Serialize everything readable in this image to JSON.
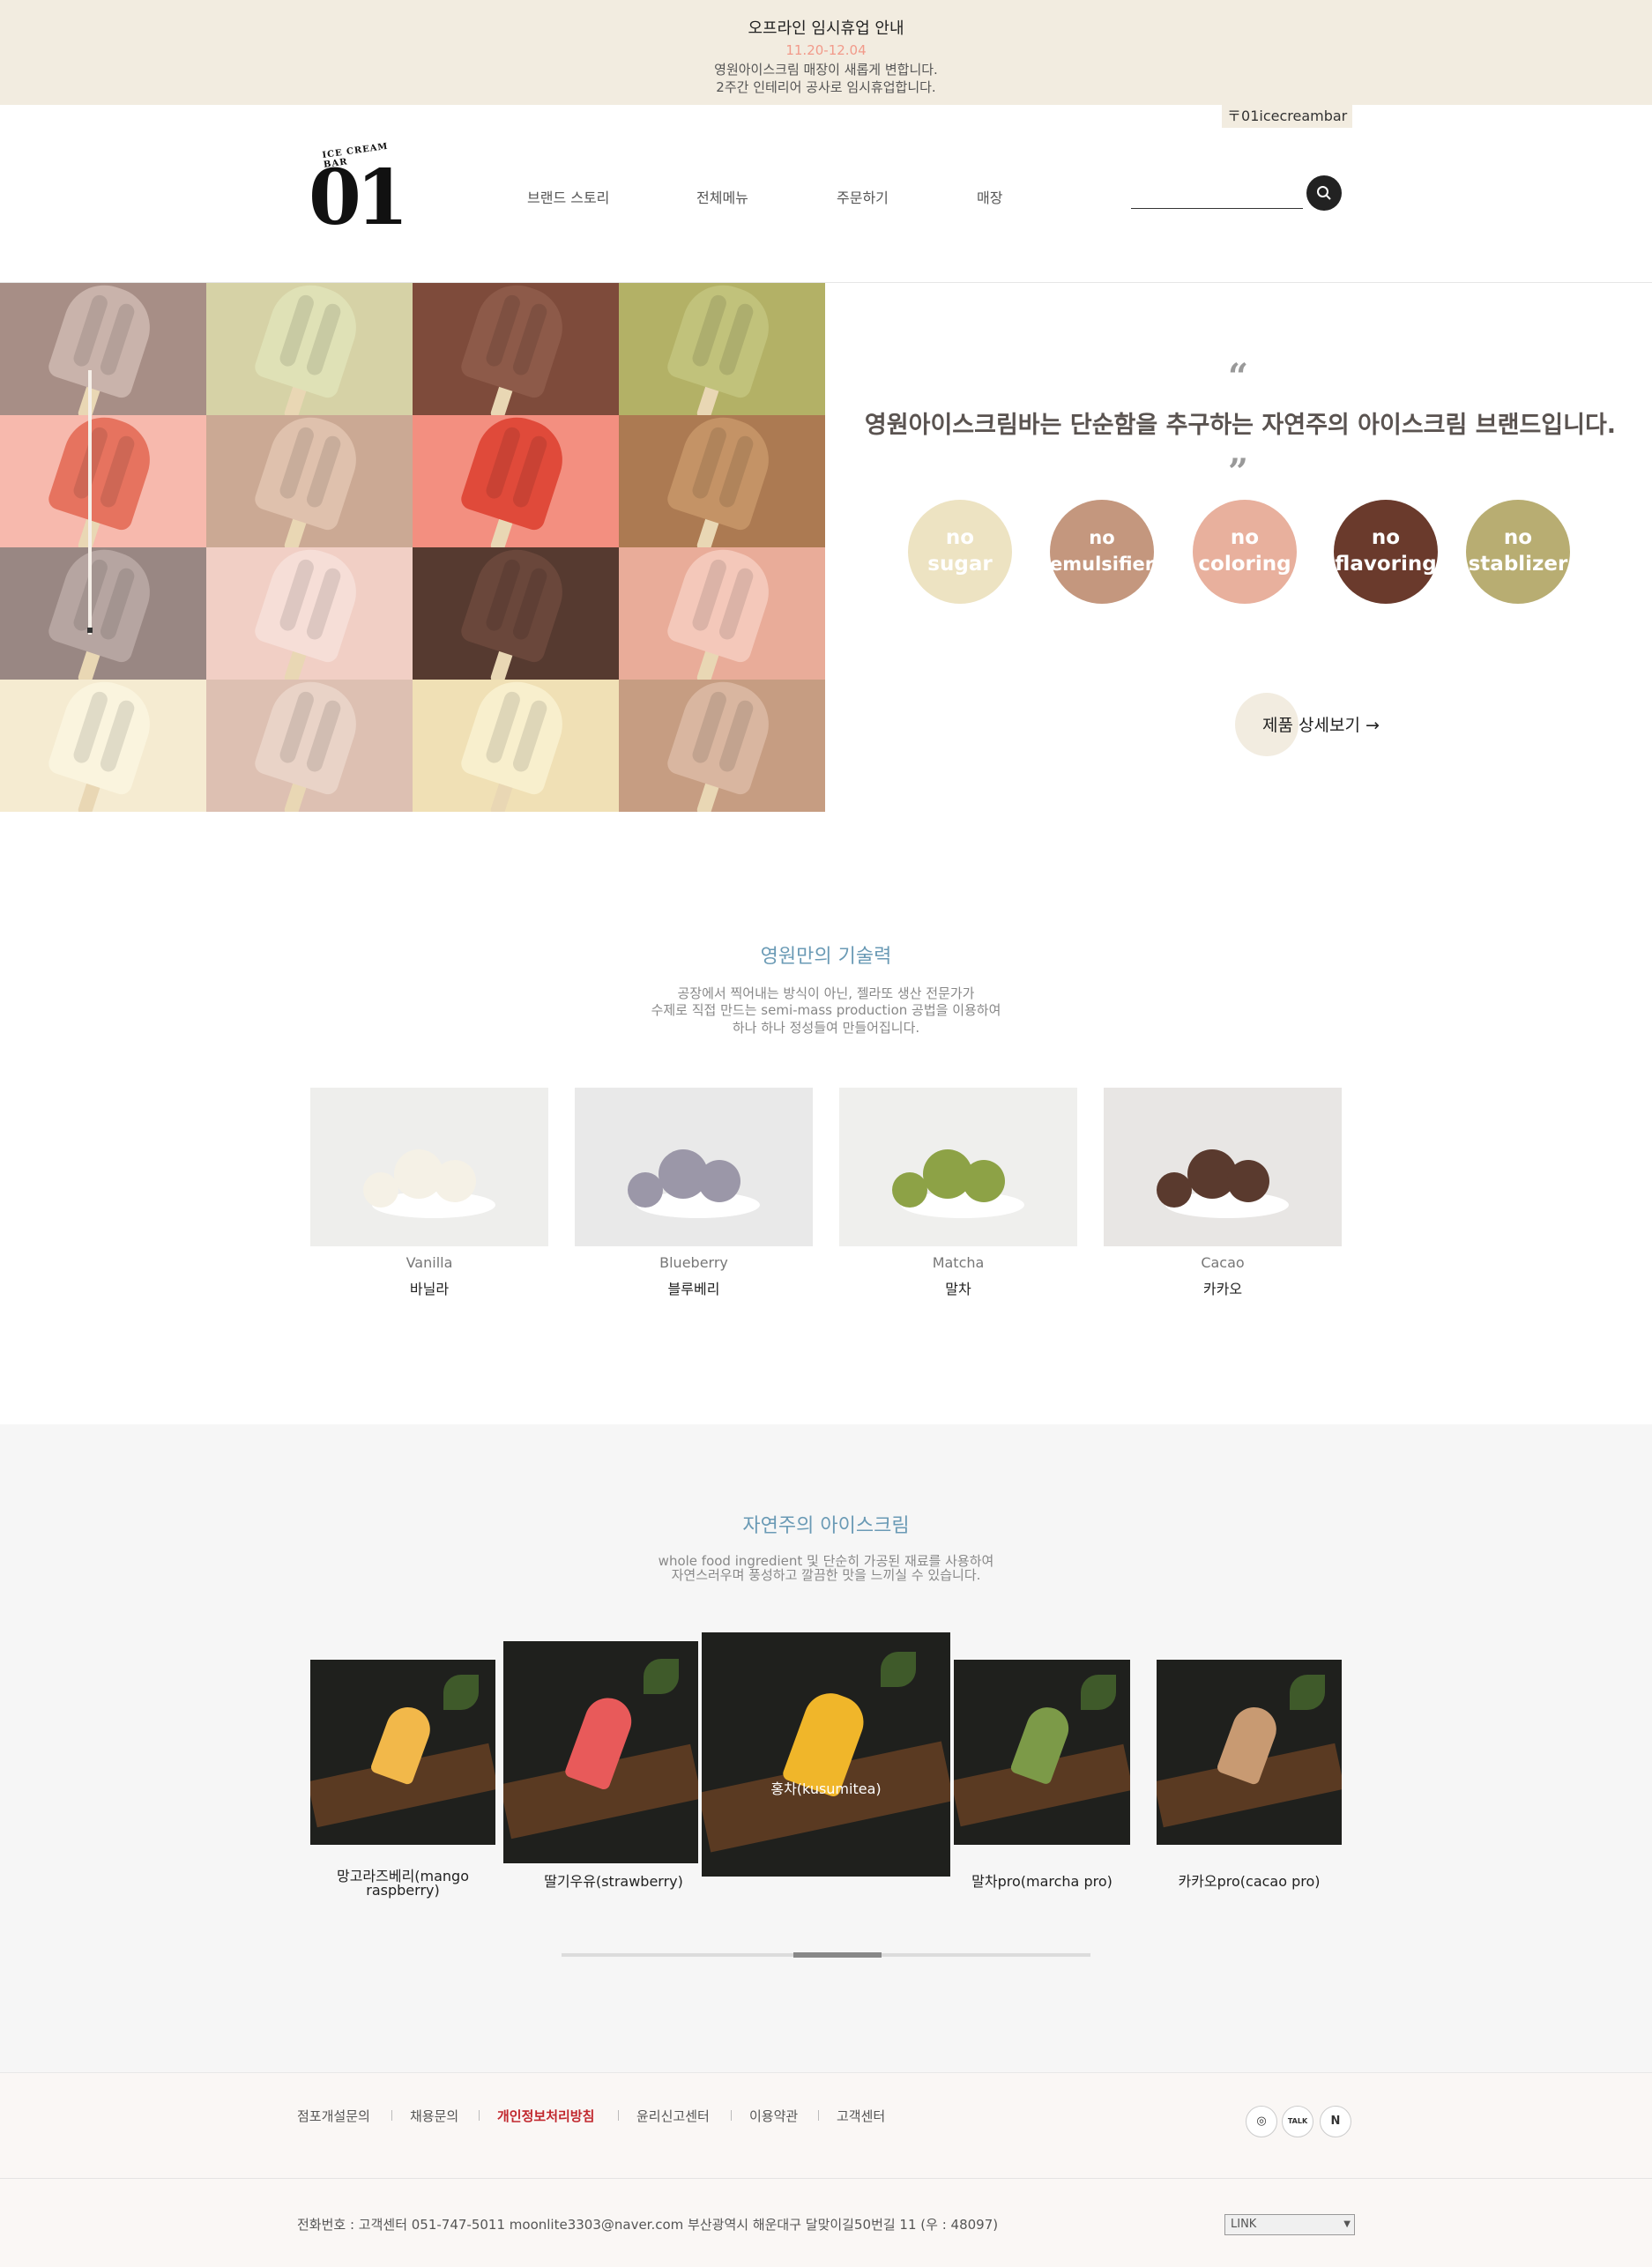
{
  "notice": {
    "title": "오프라인 임시휴업 안내",
    "date": "11.20-12.04",
    "line1": "영원아이스크림 매장이 새롭게 변합니다.",
    "line2": "2주간 인테리어 공사로 임시휴업합니다."
  },
  "header": {
    "insta_tag": "01icecreambar",
    "logo_arc": "ICE CREAM BAR",
    "logo_number": "01",
    "nav": [
      "브랜드 스토리",
      "전체메뉴",
      "주문하기",
      "매장"
    ],
    "search_placeholder": ""
  },
  "hero": {
    "headline": "영원아이스크림바는 단순함을 추구하는 자연주의 아이스크림 브랜드입니다.",
    "badges": [
      {
        "line1": "no",
        "line2": "sugar",
        "color": "#ede3c2"
      },
      {
        "line1": "no",
        "line2": "emulsifier",
        "color": "#c4977e"
      },
      {
        "line1": "no",
        "line2": "coloring",
        "color": "#e8b09d"
      },
      {
        "line1": "no",
        "line2": "flavoring",
        "color": "#6a3a2c"
      },
      {
        "line1": "no",
        "line2": "stablizer",
        "color": "#b8ad72"
      }
    ],
    "detail_button": "제품 상세보기 →",
    "tile_colors": [
      [
        "#a78e86",
        "#d6d2a6",
        "#7e4b3b",
        "#b3b166"
      ],
      [
        "#f7b9ad",
        "#cba994",
        "#f38f80",
        "#ac7a52"
      ],
      [
        "#998783",
        "#f1cfc5",
        "#563a30",
        "#e9ac99"
      ],
      [
        "#f5ebd1",
        "#ddc0b2",
        "#f0e0b5",
        "#c69d82"
      ]
    ],
    "pop_colors": [
      [
        "#c9b3ab",
        "#dfe1b6",
        "#8d5a49",
        "#c1c27b"
      ],
      [
        "#e6735f",
        "#dfc1ad",
        "#e04a3a",
        "#c49366"
      ],
      [
        "#b6a5a1",
        "#f6ded7",
        "#6a473b",
        "#f4c8ba"
      ],
      [
        "#faf4de",
        "#e9d3c7",
        "#f8efcd",
        "#d9b6a0"
      ]
    ]
  },
  "technique": {
    "title": "영원만의 기술력",
    "desc1": "공장에서 찍어내는 방식이 아닌, 젤라또 생산 전문가가",
    "desc2": "수제로 직접 만드는 semi-mass production 공법을 이용하여",
    "desc3": "하나 하나 정성들여 만들어집니다.",
    "items": [
      {
        "en": "Vanilla",
        "ko": "바닐라",
        "scoop": "#f5f1e6"
      },
      {
        "en": "Blueberry",
        "ko": "블루베리",
        "scoop": "#9b97a8"
      },
      {
        "en": "Matcha",
        "ko": "말차",
        "scoop": "#8da246"
      },
      {
        "en": "Cacao",
        "ko": "카카오",
        "scoop": "#5a3a2e"
      }
    ]
  },
  "natural": {
    "title": "자연주의 아이스크림",
    "desc1": "whole food ingredient 및 단순히 가공된 재료를 사용하여",
    "desc2": "자연스러우며 풍성하고 깔끔한 맛을 느끼실 수 있습니다.",
    "products": [
      {
        "label": "망고라즈베리(mango raspberry)",
        "accent": "#f2b84a"
      },
      {
        "label": "딸기우유(strawberry)",
        "accent": "#e85a5a"
      },
      {
        "label": "홍차(kusumitea)",
        "accent": "#f0b62a"
      },
      {
        "label": "말차pro(marcha pro)",
        "accent": "#7c9a48"
      },
      {
        "label": "카카오pro(cacao pro)",
        "accent": "#c89a72"
      }
    ]
  },
  "footer": {
    "links": [
      "점포개설문의",
      "채용문의",
      "개인정보처리방침",
      "윤리신고센터",
      "이용약관",
      "고객센터"
    ],
    "social": [
      "instagram-icon",
      "kakao-talk-icon",
      "naver-icon"
    ],
    "social_labels": [
      "◎",
      "TALK",
      "N"
    ],
    "info": "전화번호 : 고객센터 051-747-5011 moonlite3303@naver.com 부산광역시 해운대구 달맞이길50번길 11 (우 : 48097)",
    "select_value": "LINK"
  }
}
